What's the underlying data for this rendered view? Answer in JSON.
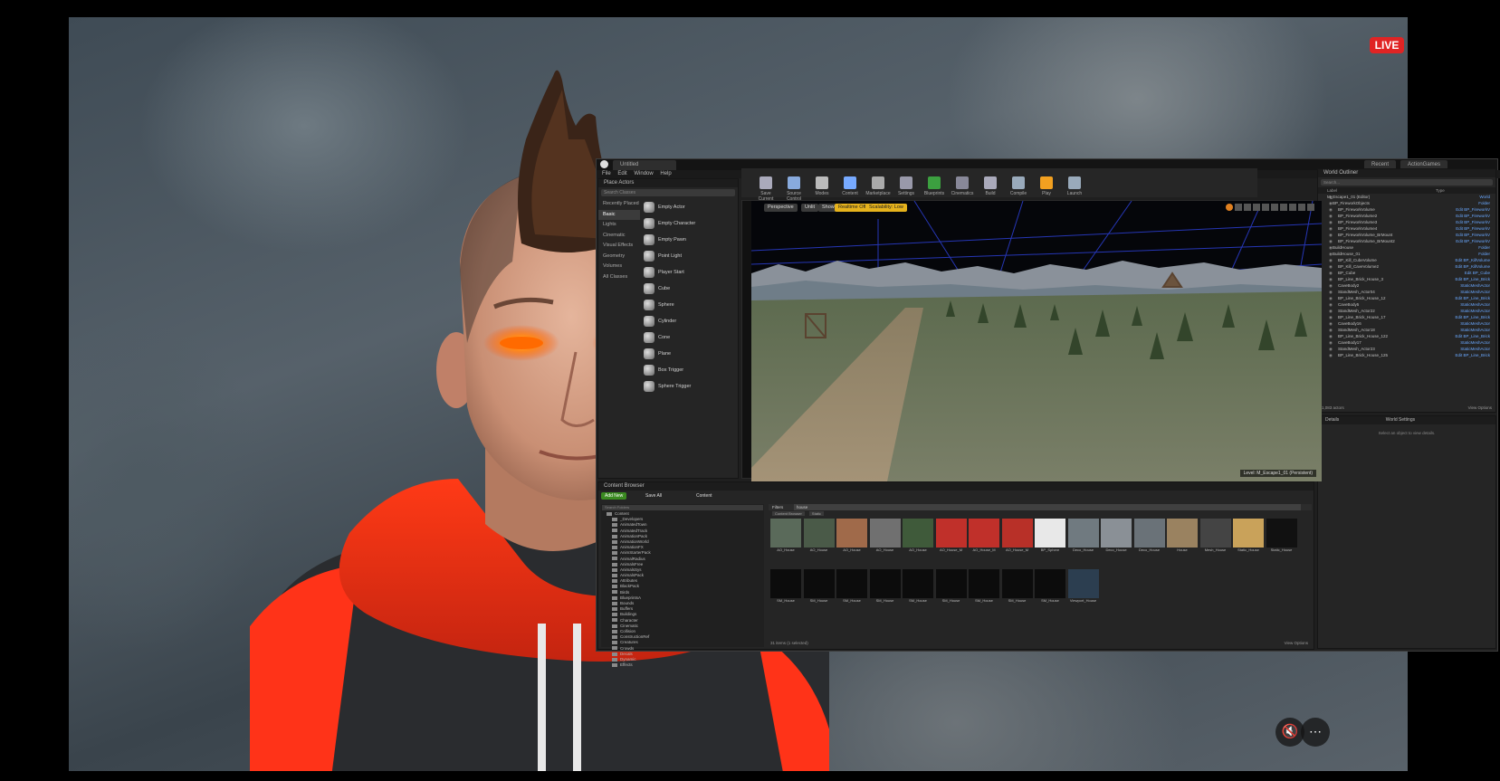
{
  "live_badge": "LIVE",
  "controls": {
    "mute_icon": "speaker-muted-icon",
    "more_icon": "more-icon"
  },
  "editor": {
    "window_tab": "Untitled",
    "menu": [
      "File",
      "Edit",
      "Window",
      "Help"
    ],
    "right_tabs": [
      "Recent",
      "ActionGames"
    ],
    "modes": {
      "title": "Place Actors",
      "search_placeholder": "Search Classes",
      "categories": [
        "Recently Placed",
        "Basic",
        "Lights",
        "Cinematic",
        "Visual Effects",
        "Geometry",
        "Volumes",
        "All Classes"
      ],
      "selected_category": "Basic",
      "actors": [
        "Empty Actor",
        "Empty Character",
        "Empty Pawn",
        "Point Light",
        "Player Start",
        "Cube",
        "Sphere",
        "Cylinder",
        "Cone",
        "Plane",
        "Box Trigger",
        "Sphere Trigger"
      ]
    },
    "toolbar": [
      "Save Current",
      "Source Control",
      "Modes",
      "Content",
      "Marketplace",
      "Settings",
      "Blueprints",
      "Cinematics",
      "Build",
      "Compile",
      "Play",
      "Launch"
    ],
    "viewport": {
      "buttons": [
        "Perspective",
        "Unlit",
        "Show"
      ],
      "warnings": [
        "Realtime Off",
        "Scalability: Low"
      ],
      "level_label": "Level: M_Escape1_01 (Persistent)"
    },
    "outliner": {
      "title": "World Outliner",
      "search_placeholder": "Search...",
      "columns": [
        "Label",
        "Type"
      ],
      "rows": [
        {
          "label": "M_Escape1_01 (Editor)",
          "type": "World"
        },
        {
          "label": "BP_FireworkObjects",
          "type": "Folder"
        },
        {
          "label": "BP_FireworkVolume",
          "type": "Edit BP_FireworkV"
        },
        {
          "label": "BP_FireworkVolume2",
          "type": "Edit BP_FireworkV"
        },
        {
          "label": "BP_FireworkVolume3",
          "type": "Edit BP_FireworkV"
        },
        {
          "label": "BP_FireworkVolume4",
          "type": "Edit BP_FireworkV"
        },
        {
          "label": "BP_FireworkVolume_BrMount",
          "type": "Edit BP_FireworkV"
        },
        {
          "label": "BP_FireworkVolume_BrMount2",
          "type": "Edit BP_FireworkV"
        },
        {
          "label": "BuildHouse",
          "type": "Folder"
        },
        {
          "label": "BuildHouse_01",
          "type": "Folder"
        },
        {
          "label": "BP_Kill_CubeVolume",
          "type": "Edit BP_KillVolume"
        },
        {
          "label": "BP_Kill_CaveVolume2",
          "type": "Edit BP_KillVolume"
        },
        {
          "label": "BP_Cube",
          "type": "Edit BP_Cube"
        },
        {
          "label": "BP_Line_Brick_House_3",
          "type": "Edit BP_Line_Brick"
        },
        {
          "label": "CaveBody2",
          "type": "StaticMeshActor"
        },
        {
          "label": "StandMesh_Actor04",
          "type": "StaticMeshActor"
        },
        {
          "label": "BP_Line_Brick_House_12",
          "type": "Edit BP_Line_Brick"
        },
        {
          "label": "CaveBody5",
          "type": "StaticMeshActor"
        },
        {
          "label": "StandMesh_Actor22",
          "type": "StaticMeshActor"
        },
        {
          "label": "BP_Line_Brick_House_17",
          "type": "Edit BP_Line_Brick"
        },
        {
          "label": "CaveBody16",
          "type": "StaticMeshActor"
        },
        {
          "label": "StandMesh_Actor18",
          "type": "StaticMeshActor"
        },
        {
          "label": "BP_Line_Brick_House_122",
          "type": "Edit BP_Line_Brick"
        },
        {
          "label": "CaveBody17",
          "type": "StaticMeshActor"
        },
        {
          "label": "StandMesh_Actor23",
          "type": "StaticMeshActor"
        },
        {
          "label": "BP_Line_Brick_House_125",
          "type": "Edit BP_Line_Brick"
        }
      ],
      "count": "1,083 actors",
      "view_options": "View Options"
    },
    "details": {
      "tabs": [
        "Details",
        "World Settings"
      ],
      "empty_text": "Select an object to view details."
    },
    "content_browser": {
      "title": "Content Browser",
      "add_new": "Add New",
      "save_all": "Save All",
      "path": "Content",
      "folder_search_placeholder": "Search Folders",
      "folders": [
        "Content",
        "_Developers",
        "AnimatedTown",
        "AnimatedTrack",
        "AnimationPack",
        "AnimationWorld",
        "AnimationFX",
        "AnimStarterPack",
        "AnimalRadius",
        "AnimalsFree",
        "AnimalsSys",
        "AnimalsPack",
        "Attributes",
        "BlackPack",
        "Birds",
        "BlueprintsA",
        "Bounds",
        "Buffers",
        "Buildings",
        "Character",
        "Cinematic",
        "Collision",
        "ConstructionRef",
        "Creatures",
        "Crowds",
        "Decals",
        "Dynamic",
        "Effects"
      ],
      "filter_label": "Filters",
      "search_value": "house",
      "filter_chips": [
        "Content Browser",
        "Static"
      ],
      "assets_row1": [
        "AO_House",
        "AO_House",
        "AO_House",
        "AO_House",
        "AO_House",
        "AO_House_M",
        "AO_House_M",
        "AO_House_M",
        "BP_Sphere",
        "Deco_House",
        "Deco_House",
        "Deco_House",
        "House",
        "Mesh_House",
        "Static_House",
        "Static_House"
      ],
      "assets_row2": [
        "SM_House",
        "SM_House",
        "SM_House",
        "SM_House",
        "SM_House",
        "SM_House",
        "SM_House",
        "SM_House",
        "SM_House",
        "Viewport_House"
      ],
      "item_count": "31 items (1 selected)",
      "view_options": "View Options"
    }
  }
}
